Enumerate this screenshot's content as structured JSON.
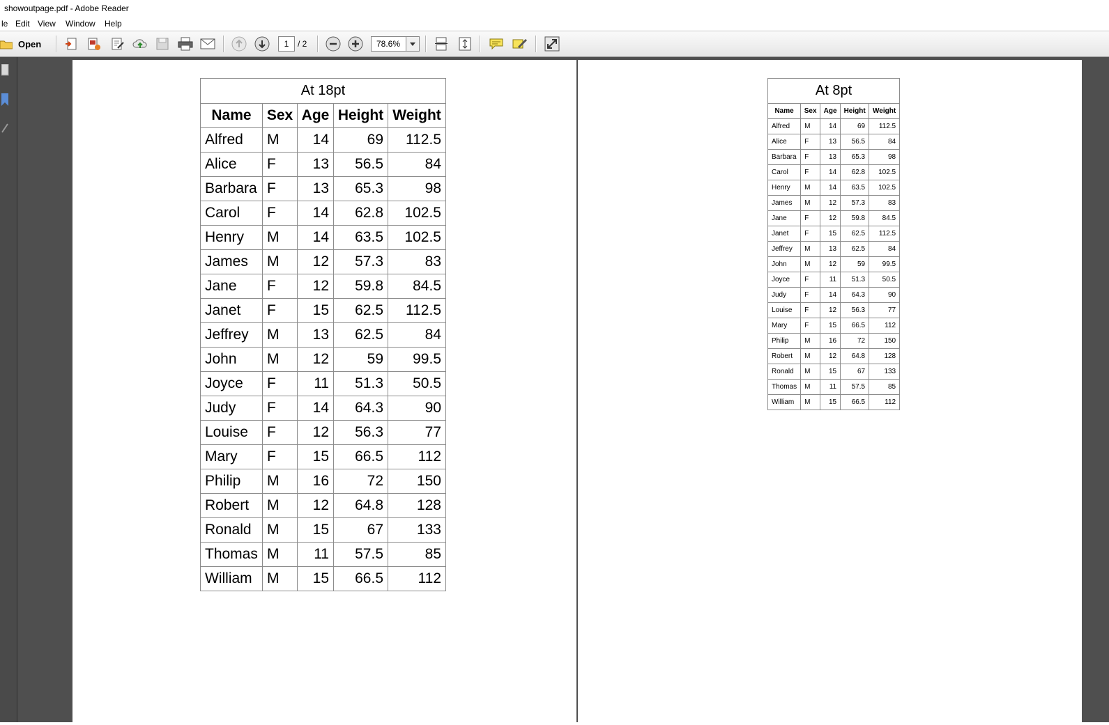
{
  "window": {
    "title": "showoutpage.pdf - Adobe Reader"
  },
  "menu": {
    "items": [
      "le",
      "Edit",
      "View",
      "Window",
      "Help"
    ]
  },
  "toolbar": {
    "open_label": "Open",
    "page_current": "1",
    "page_total": "/ 2",
    "zoom": "78.6%"
  },
  "tables": {
    "t18": {
      "caption": "At 18pt"
    },
    "t8": {
      "caption": "At 8pt"
    },
    "columns": [
      "Name",
      "Sex",
      "Age",
      "Height",
      "Weight"
    ],
    "rows": [
      [
        "Alfred",
        "M",
        "14",
        "69",
        "112.5"
      ],
      [
        "Alice",
        "F",
        "13",
        "56.5",
        "84"
      ],
      [
        "Barbara",
        "F",
        "13",
        "65.3",
        "98"
      ],
      [
        "Carol",
        "F",
        "14",
        "62.8",
        "102.5"
      ],
      [
        "Henry",
        "M",
        "14",
        "63.5",
        "102.5"
      ],
      [
        "James",
        "M",
        "12",
        "57.3",
        "83"
      ],
      [
        "Jane",
        "F",
        "12",
        "59.8",
        "84.5"
      ],
      [
        "Janet",
        "F",
        "15",
        "62.5",
        "112.5"
      ],
      [
        "Jeffrey",
        "M",
        "13",
        "62.5",
        "84"
      ],
      [
        "John",
        "M",
        "12",
        "59",
        "99.5"
      ],
      [
        "Joyce",
        "F",
        "11",
        "51.3",
        "50.5"
      ],
      [
        "Judy",
        "F",
        "14",
        "64.3",
        "90"
      ],
      [
        "Louise",
        "F",
        "12",
        "56.3",
        "77"
      ],
      [
        "Mary",
        "F",
        "15",
        "66.5",
        "112"
      ],
      [
        "Philip",
        "M",
        "16",
        "72",
        "150"
      ],
      [
        "Robert",
        "M",
        "12",
        "64.8",
        "128"
      ],
      [
        "Ronald",
        "M",
        "15",
        "67",
        "133"
      ],
      [
        "Thomas",
        "M",
        "11",
        "57.5",
        "85"
      ],
      [
        "William",
        "M",
        "15",
        "66.5",
        "112"
      ]
    ]
  }
}
